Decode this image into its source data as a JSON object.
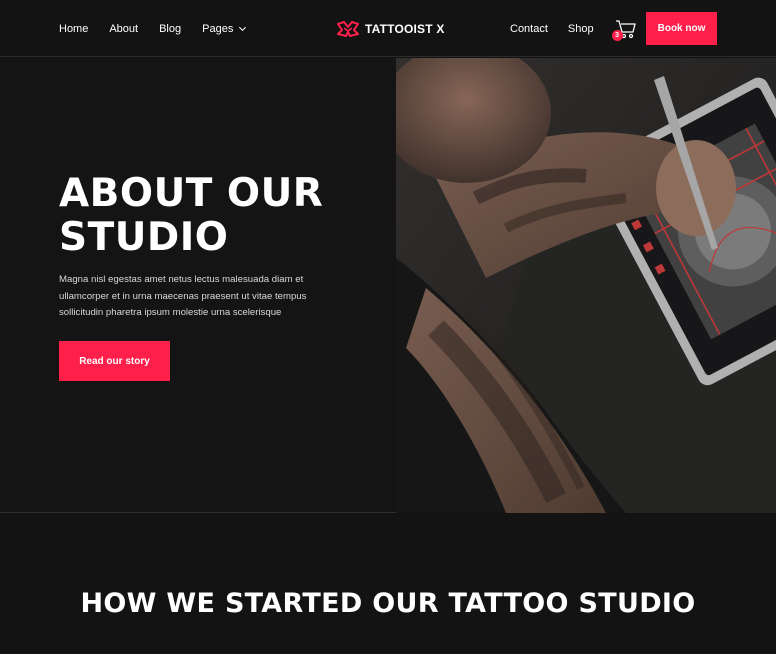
{
  "nav": {
    "left_links": [
      {
        "label": "Home"
      },
      {
        "label": "About"
      },
      {
        "label": "Blog"
      },
      {
        "label": "Pages",
        "has_dropdown": true
      }
    ],
    "logo_text": "TATTOOIST X",
    "right_links": [
      {
        "label": "Contact"
      },
      {
        "label": "Shop"
      }
    ],
    "cart_count": "3",
    "cta_label": "Book now"
  },
  "hero": {
    "title": "ABOUT OUR STUDIO",
    "text": "Magna nisl egestas amet netus lectus malesuada diam et ullamcorper et in urna maecenas praesent ut vitae tempus sollicitudin pharetra ipsum molestie urna scelerisque",
    "button_label": "Read our story"
  },
  "section2": {
    "title": "HOW WE STARTED OUR TATTOO STUDIO"
  },
  "colors": {
    "accent": "#ff1f4b",
    "background": "#131313"
  },
  "icons": [
    "logo-mark-icon",
    "chevron-down-icon",
    "cart-icon"
  ]
}
